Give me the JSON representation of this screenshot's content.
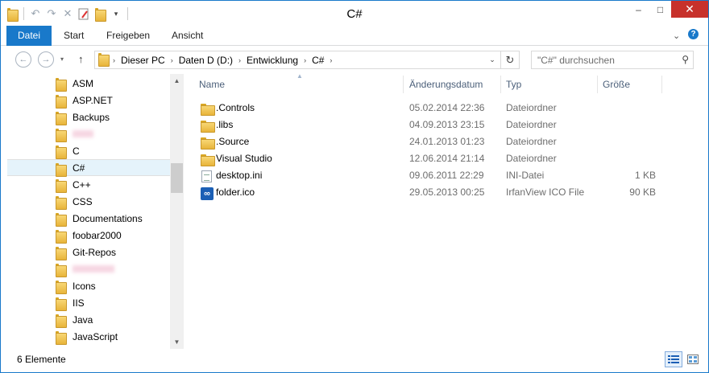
{
  "window": {
    "title": "C#",
    "controls": {
      "minimize": "–",
      "maximize": "□",
      "close": "✕"
    }
  },
  "ribbon": {
    "tabs": [
      "Datei",
      "Start",
      "Freigeben",
      "Ansicht"
    ]
  },
  "address": {
    "crumbs": [
      "Dieser PC",
      "Daten D (D:)",
      "Entwicklung",
      "C#"
    ]
  },
  "search": {
    "placeholder": "\"C#\" durchsuchen"
  },
  "nav_pane": {
    "items": [
      {
        "label": "ASM"
      },
      {
        "label": "ASP.NET"
      },
      {
        "label": "Backups"
      },
      {
        "label": "",
        "redacted": true
      },
      {
        "label": "C"
      },
      {
        "label": "C#",
        "selected": true
      },
      {
        "label": "C++"
      },
      {
        "label": "CSS"
      },
      {
        "label": "Documentations"
      },
      {
        "label": "foobar2000"
      },
      {
        "label": "Git-Repos"
      },
      {
        "label": "",
        "redacted": true
      },
      {
        "label": "Icons"
      },
      {
        "label": "IIS"
      },
      {
        "label": "Java"
      },
      {
        "label": "JavaScript"
      }
    ]
  },
  "file_list": {
    "columns": {
      "name": "Name",
      "date": "Änderungsdatum",
      "type": "Typ",
      "size": "Größe"
    },
    "rows": [
      {
        "icon": "folder-icon",
        "name": ".Controls",
        "date": "05.02.2014 22:36",
        "type": "Dateiordner",
        "size": ""
      },
      {
        "icon": "folder-icon",
        "name": ".libs",
        "date": "04.09.2013 23:15",
        "type": "Dateiordner",
        "size": ""
      },
      {
        "icon": "folder-icon",
        "name": ".Source",
        "date": "24.01.2013 01:23",
        "type": "Dateiordner",
        "size": ""
      },
      {
        "icon": "folder-icon",
        "name": "Visual Studio",
        "date": "12.06.2014 21:14",
        "type": "Dateiordner",
        "size": ""
      },
      {
        "icon": "ini-file-icon",
        "name": "desktop.ini",
        "date": "09.06.2011 22:29",
        "type": "INI-Datei",
        "size": "1 KB"
      },
      {
        "icon": "irfanview-ico-icon",
        "name": "folder.ico",
        "date": "29.05.2013 00:25",
        "type": "IrfanView ICO File",
        "size": "90 KB"
      }
    ]
  },
  "status": {
    "count": "6 Elemente"
  },
  "colors": {
    "accent": "#1979ca",
    "close": "#c7312b",
    "selection": "#e5f3fb",
    "header_text": "#4c607a"
  }
}
